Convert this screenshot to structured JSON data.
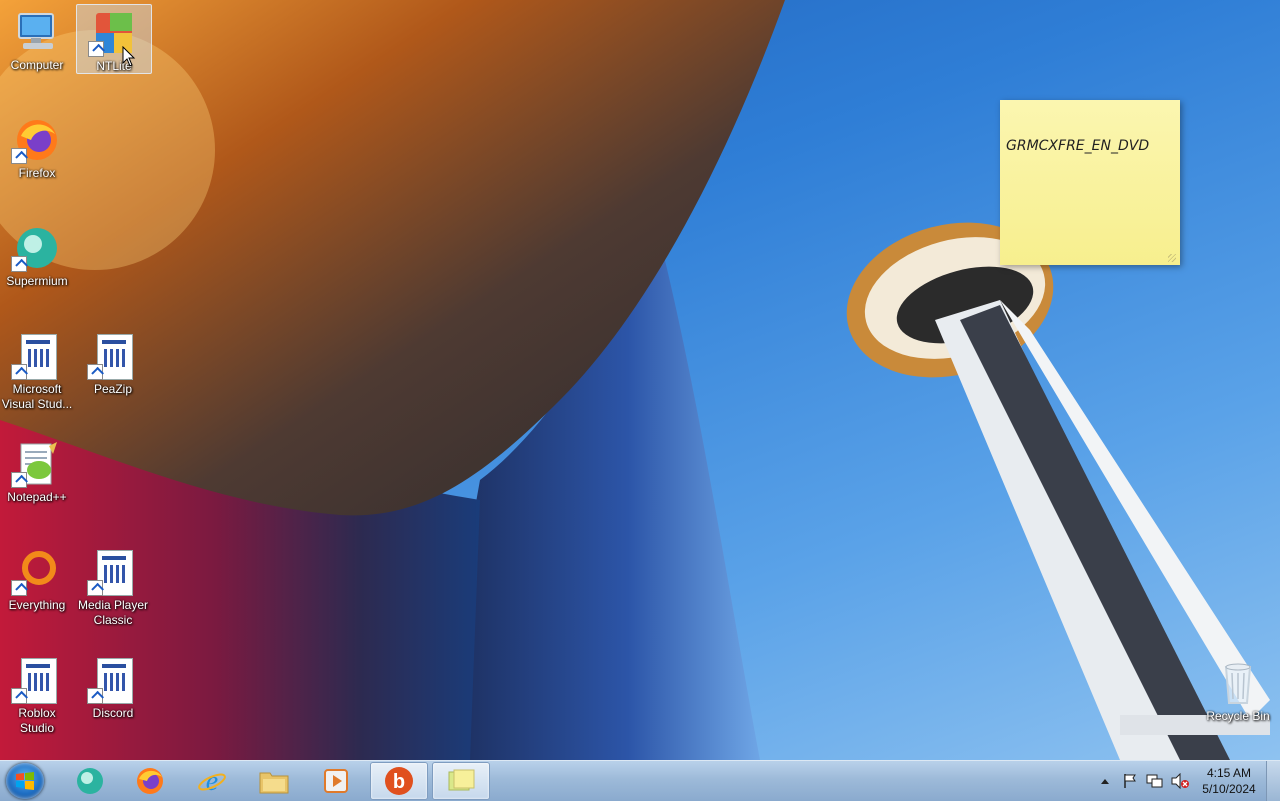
{
  "desktop_icons": [
    {
      "id": "computer",
      "label": "Computer",
      "icon": "computer-icon"
    },
    {
      "id": "ntlite",
      "label": "NTLite",
      "icon": "ntlite-icon"
    },
    {
      "id": "firefox",
      "label": "Firefox",
      "icon": "firefox-icon"
    },
    {
      "id": "supermium",
      "label": "Supermium",
      "icon": "supermium-icon"
    },
    {
      "id": "visual-studio",
      "label": "Microsoft Visual Stud...",
      "icon": "document-icon"
    },
    {
      "id": "peazip",
      "label": "PeaZip",
      "icon": "document-icon"
    },
    {
      "id": "notepadpp",
      "label": "Notepad++",
      "icon": "notepadpp-icon"
    },
    {
      "id": "everything",
      "label": "Everything",
      "icon": "everything-icon"
    },
    {
      "id": "mpc",
      "label": "Media Player Classic",
      "icon": "document-icon"
    },
    {
      "id": "roblox",
      "label": "Roblox Studio",
      "icon": "document-icon"
    },
    {
      "id": "discord",
      "label": "Discord",
      "icon": "document-icon"
    },
    {
      "id": "recycle",
      "label": "Recycle Bin",
      "icon": "recycle-bin-icon"
    }
  ],
  "sticky_note": {
    "text": "GRMCXFRE_EN_DVD"
  },
  "taskbar": {
    "start_icon": "windows-logo-icon",
    "pinned": [
      {
        "name": "supermium",
        "icon": "supermium-icon"
      },
      {
        "name": "firefox",
        "icon": "firefox-icon"
      },
      {
        "name": "internet-explorer",
        "icon": "internet-explorer-icon"
      },
      {
        "name": "file-explorer",
        "icon": "folder-icon"
      },
      {
        "name": "media-player",
        "icon": "media-player-icon"
      },
      {
        "name": "bing",
        "icon": "bing-icon",
        "active": true
      },
      {
        "name": "sticky-notes",
        "icon": "sticky-notes-icon",
        "active": true
      }
    ],
    "tray": {
      "icons": [
        "show-hidden-icons-icon",
        "action-center-flag-icon",
        "network-icon",
        "volume-muted-icon"
      ],
      "time": "4:15 AM",
      "date": "5/10/2024"
    }
  }
}
